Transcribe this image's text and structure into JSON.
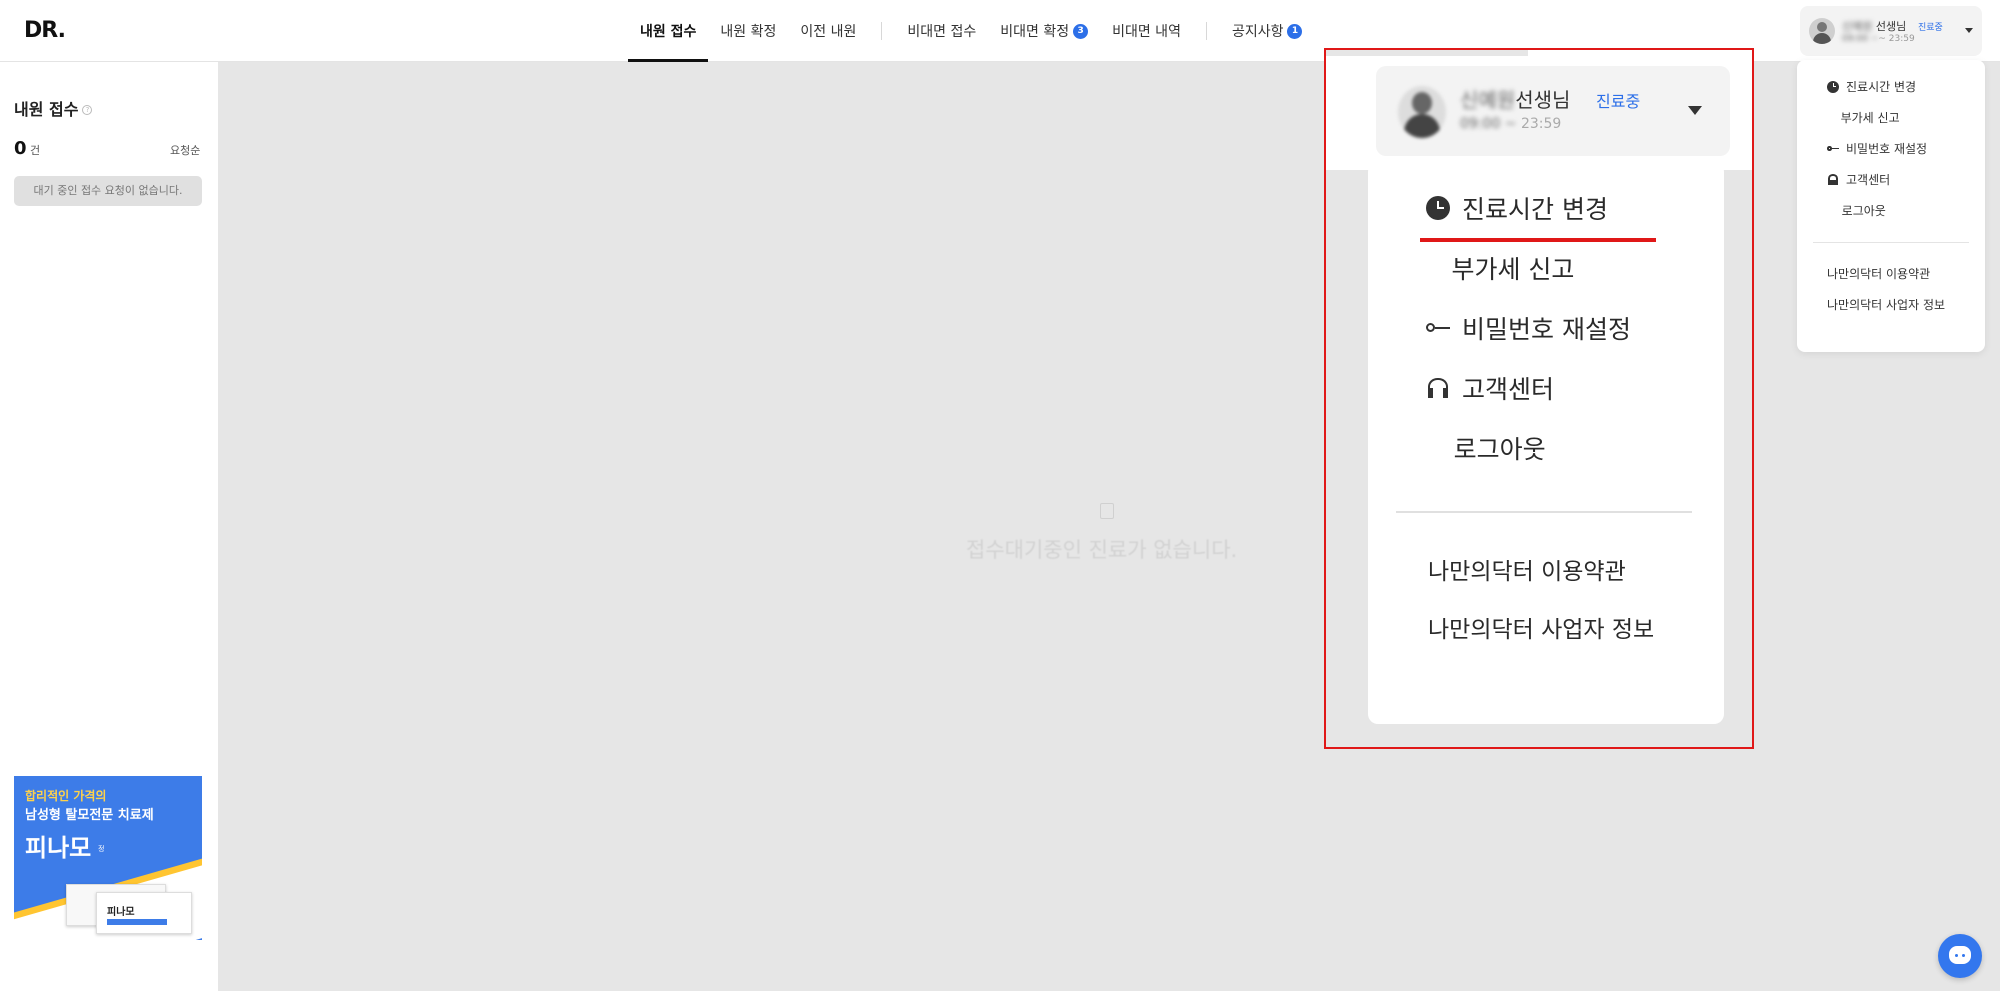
{
  "app": {
    "logo": "DR."
  },
  "nav": {
    "tabs": [
      {
        "label": "내원 접수",
        "active": true
      },
      {
        "label": "내원 확정"
      },
      {
        "label": "이전 내원"
      },
      {
        "label": "비대면 접수"
      },
      {
        "label": "비대면 확정",
        "badge": "3"
      },
      {
        "label": "비대면 내역"
      },
      {
        "label": "공지사항",
        "badge": "1"
      }
    ]
  },
  "user": {
    "name_blurred": "신예원",
    "title": "선생님",
    "status": "진료중",
    "time_blurred": "09:00 ~",
    "time": "23:59",
    "time_small": "~ 23:59"
  },
  "menu": {
    "items": [
      {
        "label": "진료시간 변경",
        "icon": "clock-icon"
      },
      {
        "label": "부가세 신고",
        "icon": "document-icon"
      },
      {
        "label": "비밀번호 재설정",
        "icon": "key-icon"
      },
      {
        "label": "고객센터",
        "icon": "headset-icon"
      },
      {
        "label": "로그아웃",
        "icon": "door-icon"
      }
    ],
    "links": [
      {
        "label": "나만의닥터 이용약관"
      },
      {
        "label": "나만의닥터 사업자 정보"
      }
    ]
  },
  "left_panel": {
    "title": "내원 접수",
    "count": "0",
    "count_unit": "건",
    "sort": "요청순",
    "empty": "대기 중인 접수 요청이 없습니다."
  },
  "ad": {
    "line1": "합리적인 가격의",
    "line2": "남성형 탈모전문 치료제",
    "product": "피나모",
    "product_sup": "정",
    "box_label": "피나모"
  },
  "main": {
    "empty_text": "접수대기중인 진료가 없습니다."
  },
  "colors": {
    "accent": "#2c6fe8",
    "highlight": "#e01818",
    "background": "#e6e6e6"
  }
}
